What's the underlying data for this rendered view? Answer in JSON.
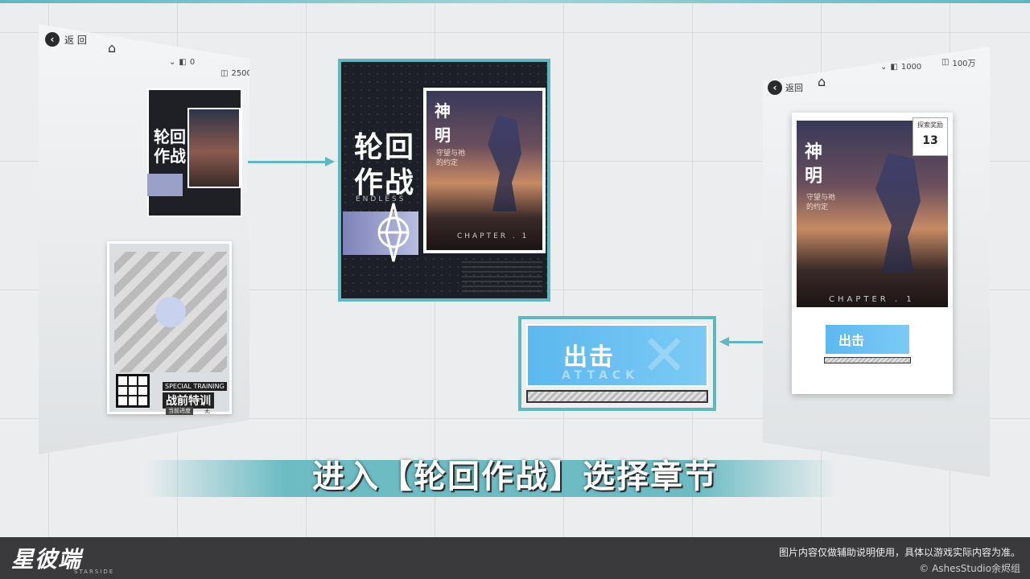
{
  "colors": {
    "accent": "#5fb7c0",
    "attack_blue": "#5cb8ee",
    "footer": "#3a3a3c"
  },
  "left_panel": {
    "back_label": "返 回",
    "currency1": "0",
    "currency2": "2500",
    "cover_title_line1": "轮回",
    "cover_title_line2": "作战",
    "training_en": "SPECIAL TRAINING",
    "training_cn": "战前特训",
    "training_sub1": "当前进度",
    "training_sub2": "无"
  },
  "center_cover": {
    "title_line1": "轮回",
    "title_line2": "作战",
    "endless": "ENDLESS",
    "art_kanji_1": "神",
    "art_kanji_2": "明",
    "art_subtitle": "守望与祂的约定",
    "chapter": "CHAPTER . 1"
  },
  "attack_button": {
    "label": "出击",
    "en": "ATTACK"
  },
  "right_panel": {
    "back_label": "返回",
    "currency1": "1000",
    "currency2": "100万",
    "reward_title": "探索奖励",
    "reward_count": "13",
    "art_kanji_1": "神",
    "art_kanji_2": "明",
    "art_subtitle": "守望与祂的约定",
    "chapter": "CHAPTER . 1",
    "attack_label": "出击"
  },
  "caption": "进入【轮回作战】选择章节",
  "footer": {
    "logo": "星彼端",
    "logo_sub": "STARSIDE",
    "disclaimer": "图片内容仅做辅助说明使用，具体以游戏实际内容为准。",
    "copyright": "© AshesStudio余烬组"
  }
}
